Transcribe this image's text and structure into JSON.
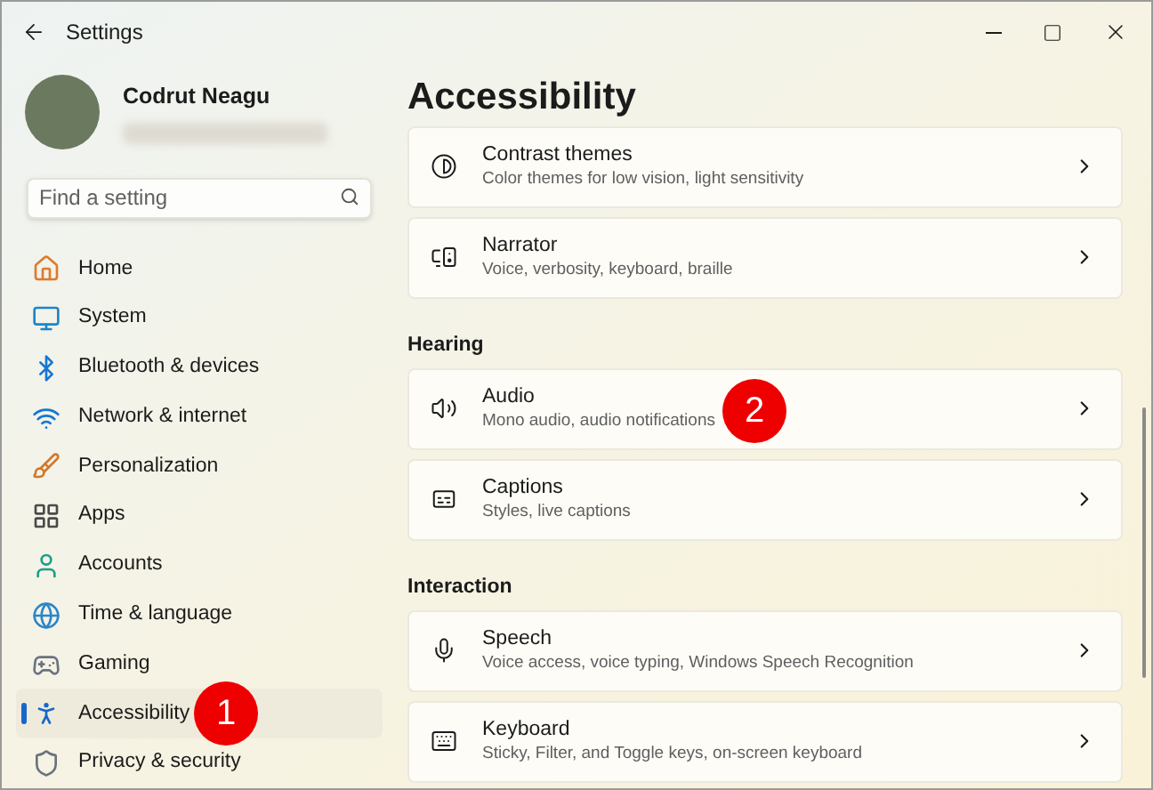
{
  "window": {
    "title": "Settings"
  },
  "profile": {
    "name": "Codrut Neagu"
  },
  "search": {
    "placeholder": "Find a setting"
  },
  "sidebar": {
    "items": [
      {
        "kind": "home",
        "label": "Home",
        "selected": false
      },
      {
        "kind": "system",
        "label": "System",
        "selected": false
      },
      {
        "kind": "bluetooth",
        "label": "Bluetooth & devices",
        "selected": false
      },
      {
        "kind": "network",
        "label": "Network & internet",
        "selected": false
      },
      {
        "kind": "personalization",
        "label": "Personalization",
        "selected": false
      },
      {
        "kind": "apps",
        "label": "Apps",
        "selected": false
      },
      {
        "kind": "accounts",
        "label": "Accounts",
        "selected": false
      },
      {
        "kind": "time",
        "label": "Time & language",
        "selected": false
      },
      {
        "kind": "gaming",
        "label": "Gaming",
        "selected": false
      },
      {
        "kind": "accessibility",
        "label": "Accessibility",
        "selected": true,
        "callout": "1"
      },
      {
        "kind": "privacy",
        "label": "Privacy & security",
        "selected": false
      }
    ]
  },
  "page": {
    "title": "Accessibility",
    "sections": [
      {
        "items": [
          {
            "kind": "contrast",
            "title": "Contrast themes",
            "subtitle": "Color themes for low vision, light sensitivity"
          },
          {
            "kind": "narrator",
            "title": "Narrator",
            "subtitle": "Voice, verbosity, keyboard, braille"
          }
        ]
      },
      {
        "heading": "Hearing",
        "items": [
          {
            "kind": "audio",
            "title": "Audio",
            "subtitle": "Mono audio, audio notifications",
            "callout": "2"
          },
          {
            "kind": "captions",
            "title": "Captions",
            "subtitle": "Styles, live captions"
          }
        ]
      },
      {
        "heading": "Interaction",
        "items": [
          {
            "kind": "speech",
            "title": "Speech",
            "subtitle": "Voice access, voice typing, Windows Speech Recognition"
          },
          {
            "kind": "keyboard",
            "title": "Keyboard",
            "subtitle": "Sticky, Filter, and Toggle keys, on-screen keyboard"
          }
        ]
      }
    ]
  }
}
